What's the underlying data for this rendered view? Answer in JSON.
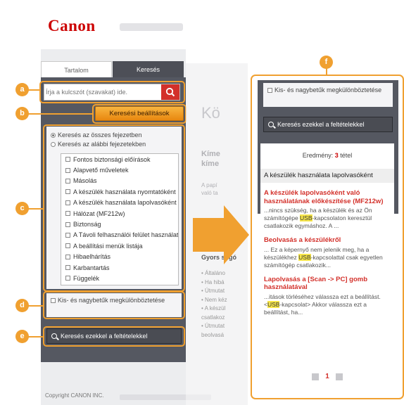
{
  "header": {
    "logo_text": "Canon"
  },
  "tabs": {
    "contents": "Tartalom",
    "search": "Keresés"
  },
  "search": {
    "placeholder": "Írja a kulcszót (szavakat) ide."
  },
  "advanced_button": "Keresési beállítások",
  "scope": {
    "all_chapters": "Keresés az összes fejezetben",
    "selected_chapters": "Keresés az alábbi fejezetekben",
    "chapters": [
      "Fontos biztonsági előírások",
      "Alapvető műveletek",
      "Másolás",
      "A készülék használata nyomtatóként",
      "A készülék használata lapolvasóként",
      "Hálózat (MF212w)",
      "Biztonság",
      "A Távoli felhasználói felület használata",
      "A beállítási menük listája",
      "Hibaelhárítás",
      "Karbantartás",
      "Függelék"
    ]
  },
  "case_sensitive": "Kis- és nagybetűk megkülönböztetése",
  "search_button": "Keresés ezekkel a feltételekkel",
  "footer": {
    "copyright": "Copyright CANON INC."
  },
  "middle": {
    "big_title": "Kö",
    "subtext_1": "Kíme kíme",
    "subtext_2": "A papí való ta",
    "gyors": "Gyors súgó",
    "items": [
      "Általáno",
      "Ha hibá",
      "Útmutat",
      "Nem kéz",
      "A készül csatlakoz",
      "Útmutat beolvasá"
    ]
  },
  "results": {
    "count_label": "Eredmény:",
    "count_value": "3",
    "count_unit": "tétel",
    "group_title": "A készülék használata lapolvasóként",
    "items": [
      {
        "title": "A készülék lapolvasóként való használatának előkészítése (MF212w)",
        "snippet_pre": "...nincs szükség, ha a készülék és az Ön számítógépe ",
        "highlight": "USB",
        "snippet_post": "-kapcsolaton keresztül csatlakozik egymáshoz.  A ..."
      },
      {
        "title": "Beolvasás a készülékről",
        "snippet_pre": "... Ez a képernyő nem jelenik meg, ha a készülékhez ",
        "highlight": "USB",
        "snippet_post": "-kapcsolattal csak egyetlen számítógép csatlakozik..."
      },
      {
        "title": "Lapolvasás a [Scan -> PC] gomb használatával",
        "snippet_pre": "...itások törléséhez válassza ezt a beállítást.  <",
        "highlight": "USB",
        "snippet_post": "-kapcsolat>  Akkor válassza ezt a beállítást, ha..."
      }
    ],
    "page": "1"
  },
  "callouts": [
    "a",
    "b",
    "c",
    "d",
    "e",
    "f"
  ],
  "colors": {
    "accent": "#f0a030",
    "brand_red": "#cc0000",
    "panel_dark": "#555861"
  }
}
